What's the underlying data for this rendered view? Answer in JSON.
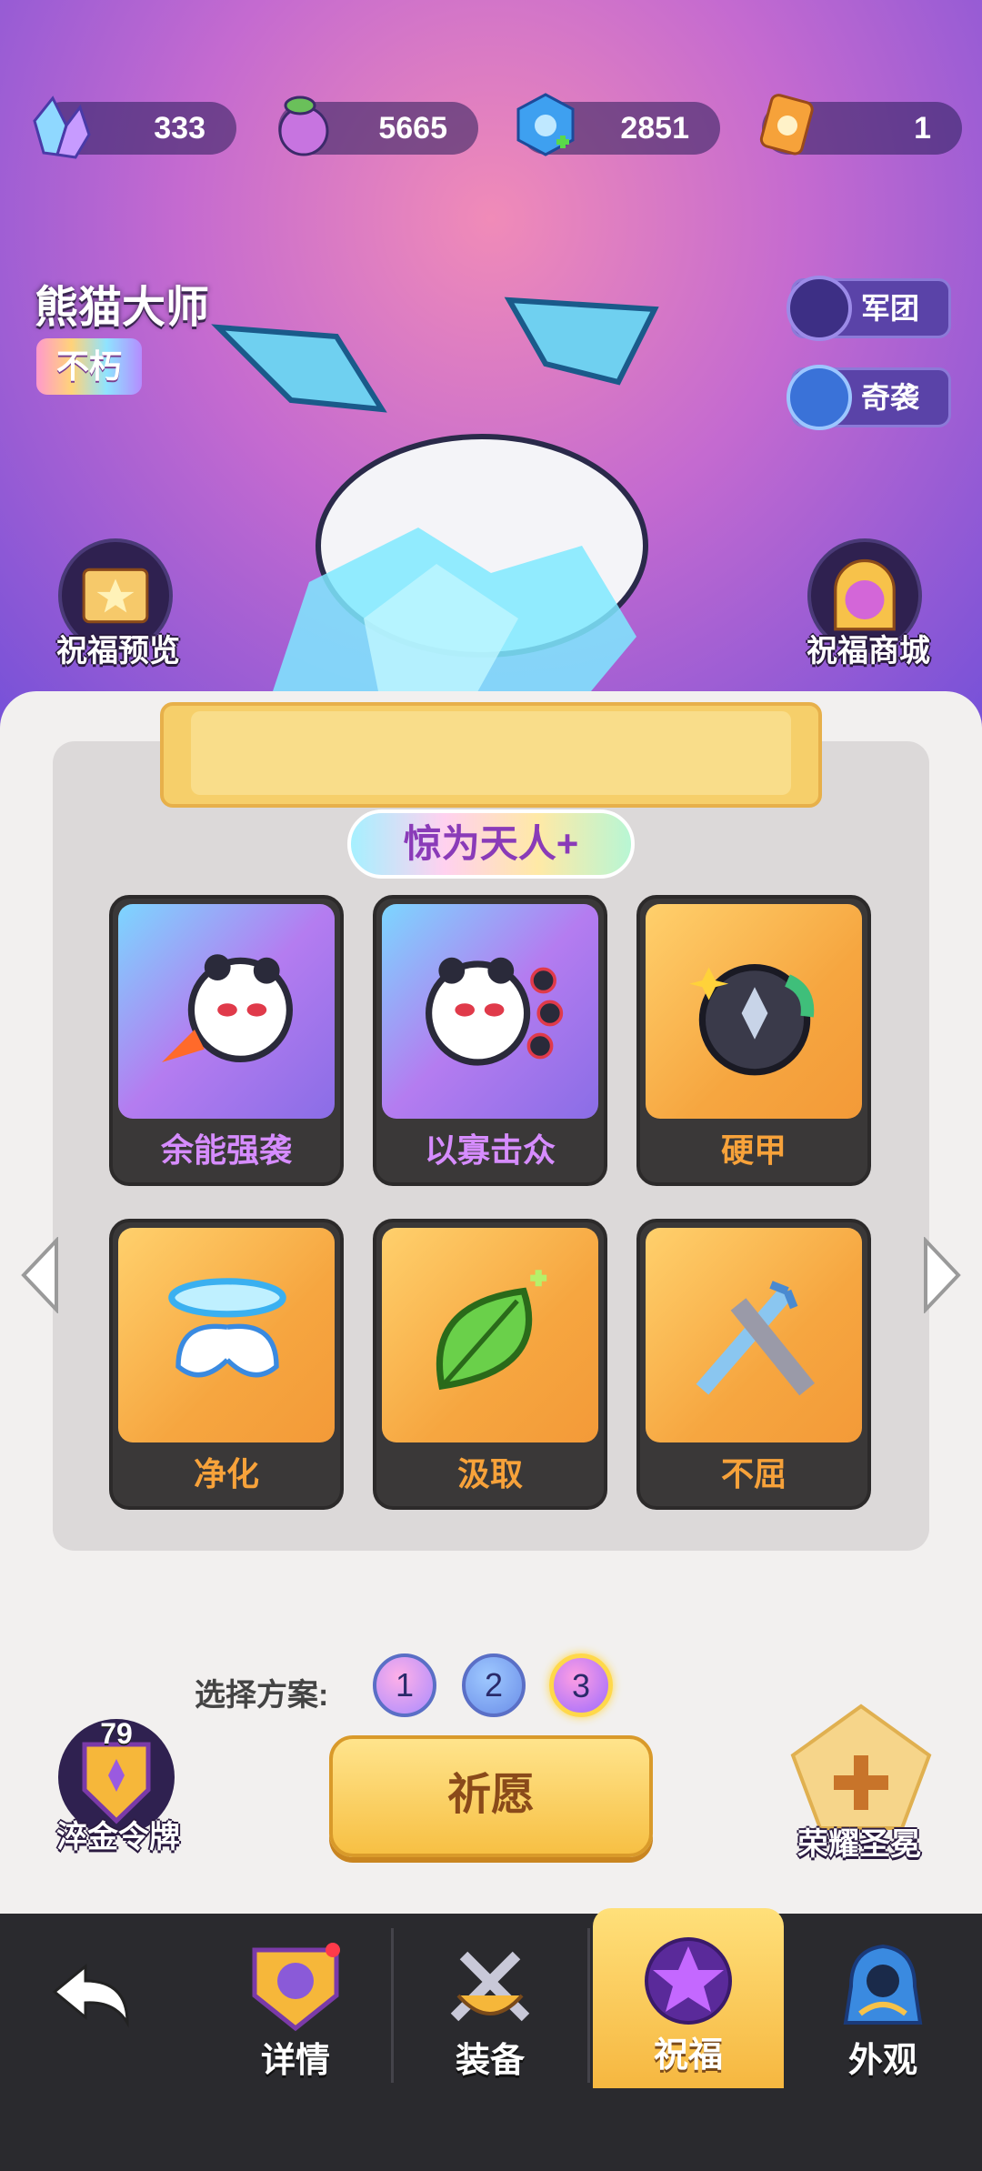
{
  "currencies": [
    {
      "icon": "crystal-icon",
      "value": "333"
    },
    {
      "icon": "potion-icon",
      "value": "5665"
    },
    {
      "icon": "blue-gem-icon",
      "value": "2851"
    },
    {
      "icon": "ticket-icon",
      "value": "1"
    }
  ],
  "hero": {
    "name": "熊猫大师",
    "rarity": "不朽"
  },
  "side_buttons": {
    "legion": "军团",
    "raid": "奇袭"
  },
  "round_actions": {
    "preview": "祝福预览",
    "shop": "祝福商城"
  },
  "title_pill": "惊为天人+",
  "blessings": [
    {
      "name": "余能强袭",
      "style": "purple",
      "icon": "panda-dash-icon"
    },
    {
      "name": "以寡击众",
      "style": "purple",
      "icon": "panda-multi-icon"
    },
    {
      "name": "硬甲",
      "style": "orange",
      "icon": "armor-orb-icon"
    },
    {
      "name": "净化",
      "style": "orange",
      "icon": "halo-wings-icon"
    },
    {
      "name": "汲取",
      "style": "orange",
      "icon": "leaf-icon"
    },
    {
      "name": "不屈",
      "style": "orange",
      "icon": "swords-icon"
    }
  ],
  "plan": {
    "label": "选择方案:",
    "options": [
      "1",
      "2",
      "3"
    ],
    "selected": "3"
  },
  "wish_button": "祈愿",
  "medal": {
    "level": "79",
    "label": "淬金令牌"
  },
  "glory": {
    "label": "荣耀圣冕"
  },
  "nav": {
    "back": "back-arrow-icon",
    "items": [
      {
        "label": "详情",
        "icon": "helmet-shield-icon"
      },
      {
        "label": "装备",
        "icon": "crossed-swords-icon"
      },
      {
        "label": "祝福",
        "icon": "star-orb-icon"
      },
      {
        "label": "外观",
        "icon": "hooded-figure-icon"
      }
    ],
    "active": "祝福"
  },
  "colors": {
    "accent": "#f6b740",
    "purple_card": "#b47cf0",
    "orange_card": "#f6a640"
  }
}
